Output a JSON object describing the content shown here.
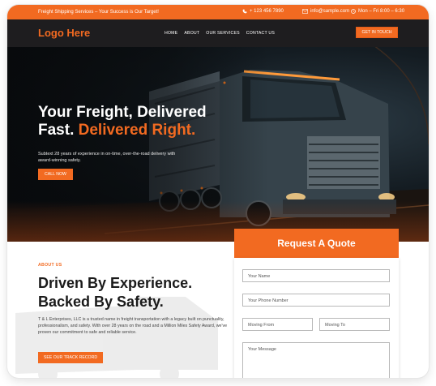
{
  "colors": {
    "accent": "#f26a21",
    "nav_bg": "#1e1d1f",
    "dark_text": "#1a1a1a"
  },
  "topbar": {
    "tagline": "Freight Shipping Services – Your Success is Our Target!",
    "phone": "+ 123 456 7890",
    "email": "info@sample.com",
    "hours": "Mon – Fri 8:00 – 6:30",
    "icons": [
      "phone-icon",
      "email-icon",
      "clock-icon"
    ]
  },
  "nav": {
    "logo": "Logo Here",
    "items": [
      "HOME",
      "ABOUT",
      "OUR SERVICES",
      "CONTACT US"
    ],
    "cta": "GET IN TOUCH"
  },
  "hero": {
    "title_line1": "Your Freight, Delivered",
    "title_line2_white": "Fast.",
    "title_line2_accent": "Delivered Right.",
    "subtitle": "Subtext 28 years of experience in on-time, over-the-road delivery with award-winning safety.",
    "button": "CALL NOW"
  },
  "about": {
    "label": "ABOUT US",
    "title_line1": "Driven By Experience.",
    "title_line2": "Backed By Safety.",
    "text": "T & L Enterprises, LLC is a trusted name in freight transportation with a legacy built on punctuality, professionalism, and safety. With over 28 years on the road and a Million Miles Safety Award, we've proven our commitment to safe and reliable service.",
    "button": "SEE OUR TRACK RECORD"
  },
  "quote": {
    "title": "Request A Quote",
    "fields": {
      "name": "Your Name",
      "phone": "Your Phone Number",
      "from": "Moving From",
      "to": "Moving To",
      "message": "Your Message"
    }
  }
}
